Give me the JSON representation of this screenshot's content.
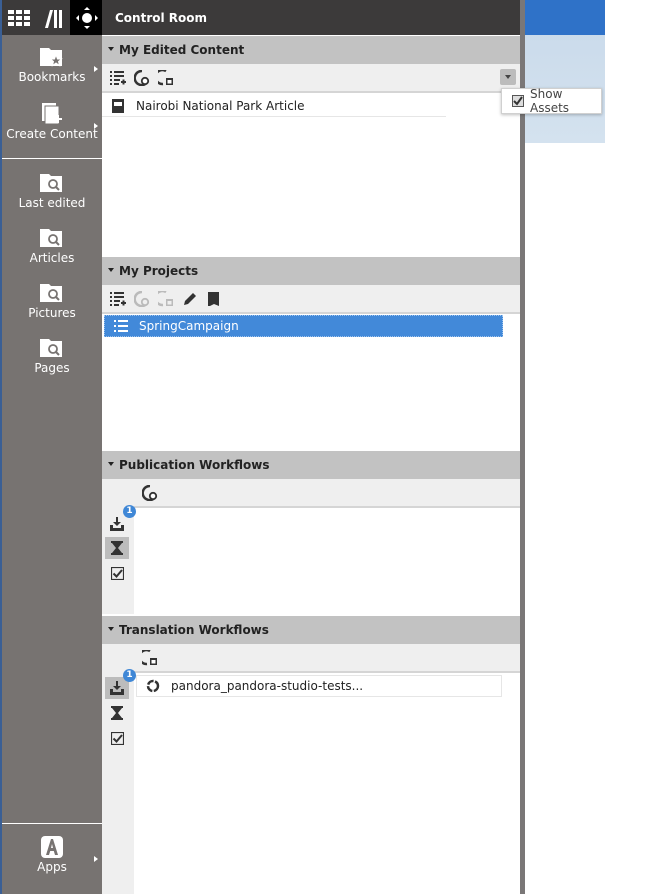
{
  "sidebar": {
    "top_icons": [
      {
        "name": "apps-grid-icon"
      },
      {
        "name": "library-icon"
      },
      {
        "name": "control-room-icon",
        "active": true
      }
    ],
    "items": [
      {
        "label": "Bookmarks",
        "icon": "folder-star-icon",
        "has_submenu": true
      },
      {
        "label": "Create Content",
        "icon": "new-document-icon",
        "has_submenu": true
      },
      {
        "label": "Last edited",
        "icon": "folder-search-icon"
      },
      {
        "label": "Articles",
        "icon": "folder-search-icon"
      },
      {
        "label": "Pictures",
        "icon": "folder-search-icon"
      },
      {
        "label": "Pages",
        "icon": "folder-search-icon"
      }
    ],
    "apps": {
      "label": "Apps",
      "icon": "apps-a-icon",
      "has_submenu": true
    }
  },
  "panel": {
    "title": "Control Room",
    "sections": {
      "edited": {
        "title": "My Edited Content",
        "items": [
          {
            "label": "Nairobi National Park Article",
            "icon": "article-icon"
          }
        ]
      },
      "projects": {
        "title": "My Projects",
        "items": [
          {
            "label": "SpringCampaign",
            "icon": "list-icon",
            "selected": true
          }
        ]
      },
      "publication": {
        "title": "Publication Workflows",
        "inbox_badge": "1",
        "items": []
      },
      "translation": {
        "title": "Translation Workflows",
        "inbox_badge": "1",
        "items": [
          {
            "label": "pandora_pandora-studio-tests...",
            "icon": "workflow-icon"
          }
        ]
      }
    }
  },
  "popup": {
    "show_assets_label": "Show Assets",
    "show_assets_checked": true
  },
  "colors": {
    "accent": "#4289d9",
    "sidebar": "#777371",
    "topbar": "#3c3a3a",
    "badge": "#3f87d6"
  }
}
